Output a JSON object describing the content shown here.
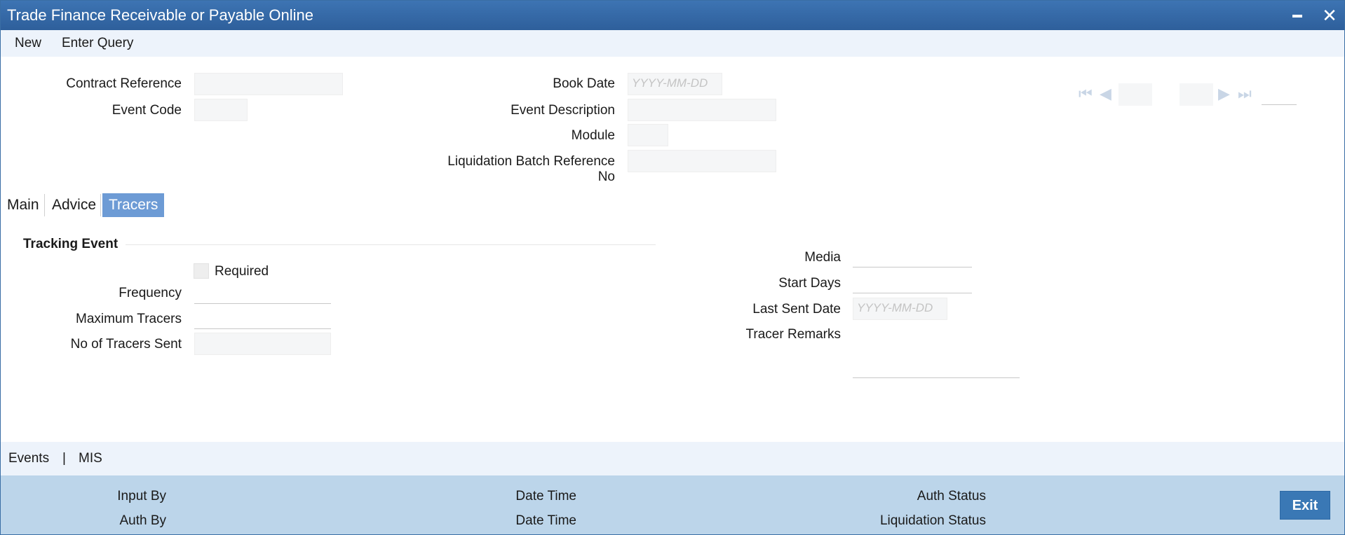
{
  "window": {
    "title": "Trade Finance Receivable or Payable Online"
  },
  "menu": {
    "new": "New",
    "enter_query": "Enter Query"
  },
  "header": {
    "contract_reference": {
      "label": "Contract Reference",
      "value": ""
    },
    "event_code": {
      "label": "Event Code",
      "value": ""
    },
    "book_date": {
      "label": "Book Date",
      "placeholder": "YYYY-MM-DD"
    },
    "event_description": {
      "label": "Event Description",
      "value": ""
    },
    "module": {
      "label": "Module",
      "value": ""
    },
    "liquidation_batch_reference": {
      "label_line1": "Liquidation Batch Reference",
      "label_line2": "No",
      "value": ""
    }
  },
  "tabs": [
    {
      "label": "Main",
      "active": false
    },
    {
      "label": "Advice",
      "active": false
    },
    {
      "label": "Tracers",
      "active": true
    }
  ],
  "tracers": {
    "section_title": "Tracking Event",
    "required": {
      "label": "Required",
      "checked": false
    },
    "frequency": {
      "label": "Frequency",
      "value": ""
    },
    "maximum_tracers": {
      "label": "Maximum Tracers",
      "value": ""
    },
    "no_of_tracers_sent": {
      "label": "No of Tracers Sent",
      "value": ""
    },
    "media": {
      "label": "Media",
      "value": ""
    },
    "start_days": {
      "label": "Start Days",
      "value": ""
    },
    "last_sent_date": {
      "label": "Last Sent Date",
      "placeholder": "YYYY-MM-DD"
    },
    "tracer_remarks": {
      "label": "Tracer Remarks",
      "value": ""
    }
  },
  "bottom_nav": {
    "events": "Events",
    "separator": "|",
    "mis": "MIS"
  },
  "footer": {
    "input_by": "Input By",
    "auth_by": "Auth By",
    "date_time_1": "Date Time",
    "date_time_2": "Date Time",
    "auth_status": "Auth Status",
    "liquidation_status": "Liquidation Status",
    "exit": "Exit"
  },
  "colors": {
    "titlebar": "#2e5f9b",
    "active_tab": "#6d9bd5",
    "footer": "#bcd5ea",
    "exit_button": "#3a78b5"
  }
}
